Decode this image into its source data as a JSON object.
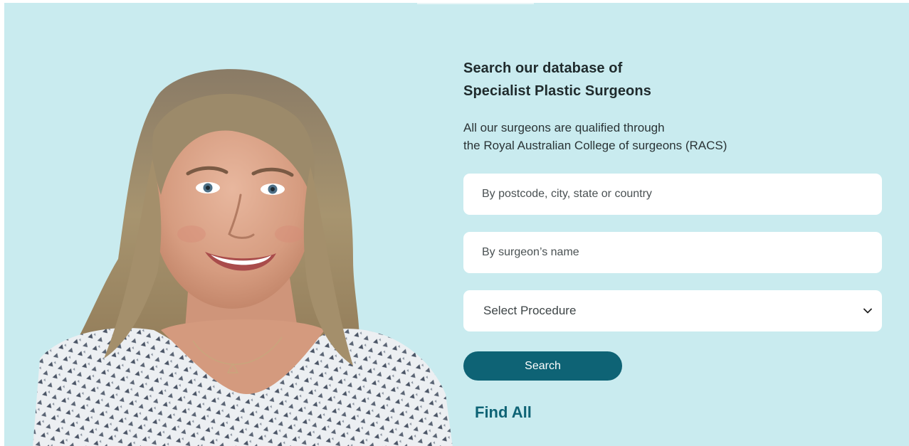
{
  "search_panel": {
    "heading_line1": "Search our database of",
    "heading_line2": "Specialist Plastic Surgeons",
    "subtext_line1": "All our surgeons are qualified through",
    "subtext_line2": "the Royal Australian College of surgeons (RACS)",
    "location_placeholder": "By postcode, city, state or country",
    "name_placeholder": "By surgeon’s name",
    "procedure_selected": "Select Procedure",
    "search_label": "Search",
    "find_all_label": "Find All"
  },
  "icons": {
    "dropdown": "chevron-down-icon"
  },
  "colors": {
    "background": "#c9ebef",
    "accent": "#0e6375",
    "field_bg": "#ffffff",
    "heading_text": "#1f2a2c"
  }
}
